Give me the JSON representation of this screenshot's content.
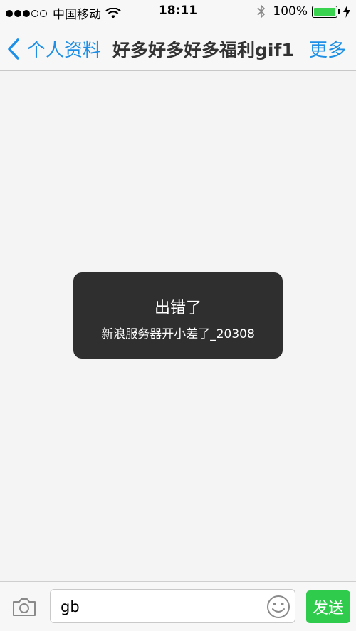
{
  "status_bar": {
    "carrier": "中国移动",
    "time": "18:11",
    "battery_percent": "100%",
    "battery_level": 1.0,
    "signal_bars_filled": 3,
    "signal_bars_total": 5,
    "icons": [
      "wifi-icon",
      "bluetooth-icon",
      "battery-icon",
      "charging-bolt-icon"
    ]
  },
  "nav": {
    "back_label": "个人资料",
    "title": "好多好多好多福利gif1",
    "more_label": "更多",
    "accent_color": "#1d8fe6"
  },
  "toast": {
    "title": "出错了",
    "message": "新浪服务器开小差了_20308"
  },
  "input_bar": {
    "text_value": "gb",
    "send_label": "发送",
    "send_color": "#2ecb4d",
    "icons": [
      "camera-icon",
      "emoji-icon"
    ]
  }
}
